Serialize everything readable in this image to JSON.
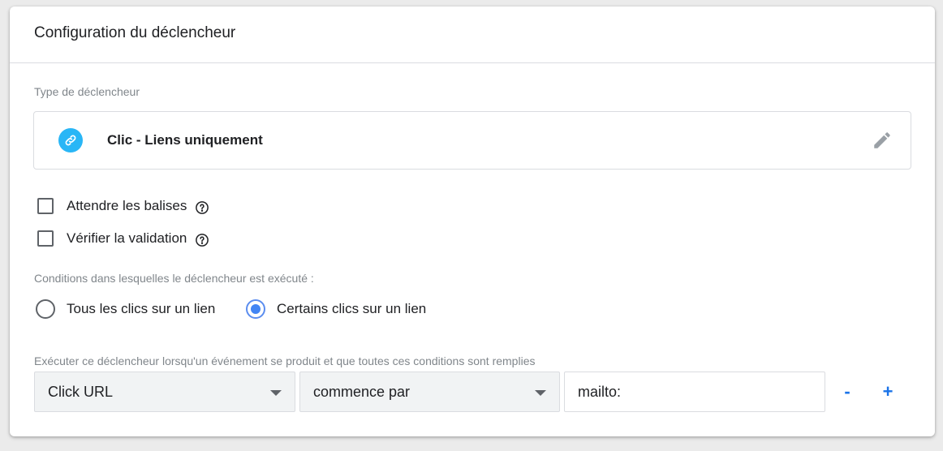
{
  "card": {
    "title": "Configuration du déclencheur"
  },
  "trigger_type": {
    "label": "Type de déclencheur",
    "name": "Clic - Liens uniquement",
    "icon": "link-icon",
    "icon_color": "#29b6f6"
  },
  "options": {
    "wait_for_tags": {
      "label": "Attendre les balises",
      "checked": false
    },
    "check_validation": {
      "label": "Vérifier la validation",
      "checked": false
    }
  },
  "conditions": {
    "label": "Conditions dans lesquelles le déclencheur est exécuté :",
    "all_clicks": {
      "label": "Tous les clics sur un lien",
      "selected": false
    },
    "some_clicks": {
      "label": "Certains clics sur un lien",
      "selected": true
    }
  },
  "filter": {
    "label": "Exécuter ce déclencheur lorsqu'un événement se produit et que toutes ces conditions sont remplies",
    "variable": "Click URL",
    "operator": "commence par",
    "value": "mailto:",
    "remove_label": "-",
    "add_label": "+"
  },
  "colors": {
    "accent": "#1a73e8",
    "radio_selected": "#4285f4"
  }
}
